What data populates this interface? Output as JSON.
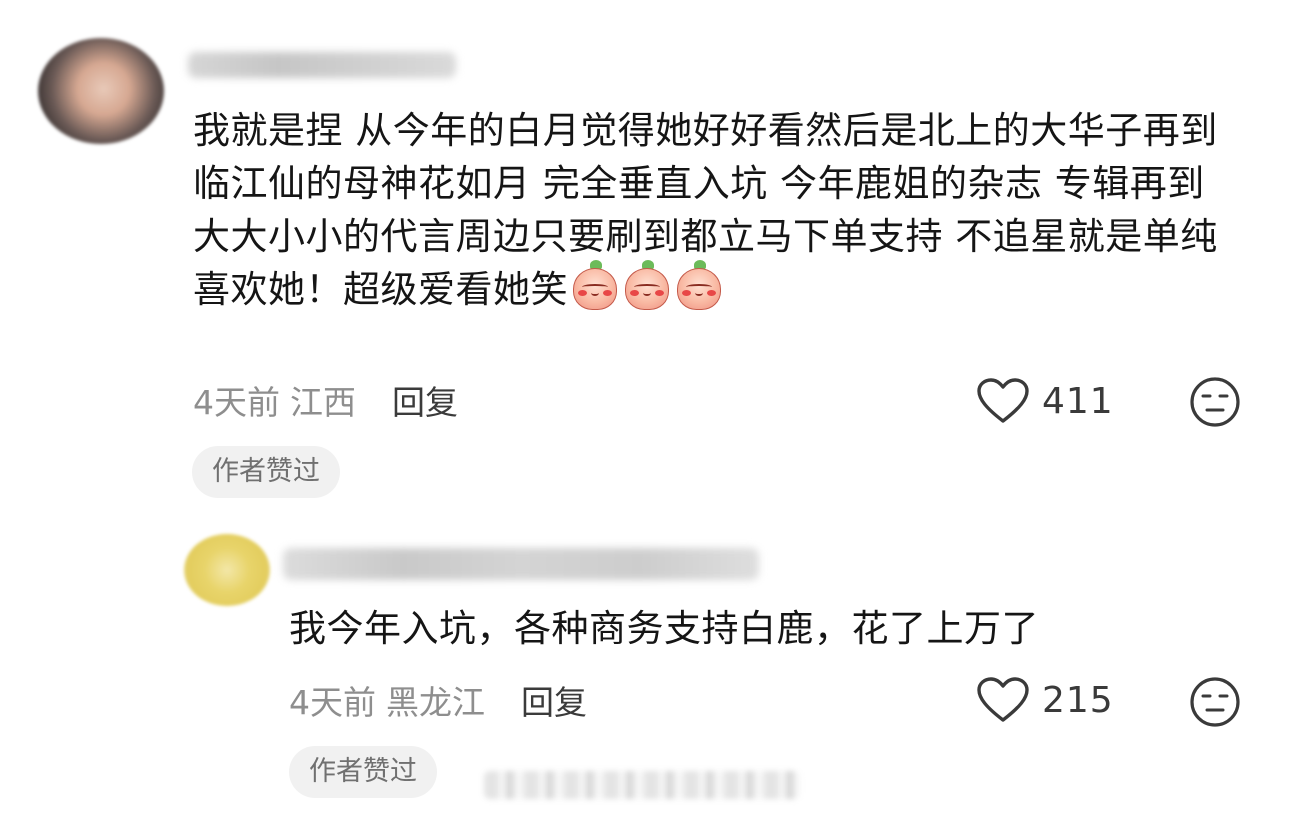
{
  "comments": [
    {
      "text": "我就是捏 从今年的白月觉得她好好看然后是北上的大华子再到临江仙的母神花如月 完全垂直入坑 今年鹿姐的杂志 专辑再到大大小小的代言周边只要刷到都立马下单支持 不追星就是单纯喜欢她！超级爱看她笑",
      "emojis": [
        "emoji-blush",
        "emoji-blush",
        "emoji-blush"
      ],
      "time": "4天前",
      "location": "江西",
      "reply_label": "回复",
      "likes": "411",
      "badge": "作者赞过"
    },
    {
      "text": "我今年入坑，各种商务支持白鹿，花了上万了",
      "time": "4天前",
      "location": "黑龙江",
      "reply_label": "回复",
      "likes": "215",
      "badge": "作者赞过"
    }
  ],
  "icons": {
    "like": "heart-outline-icon",
    "reaction": "neutral-face-icon"
  },
  "colors": {
    "meta_gray": "#8e8e8e",
    "badge_bg": "#f1f1f1"
  }
}
